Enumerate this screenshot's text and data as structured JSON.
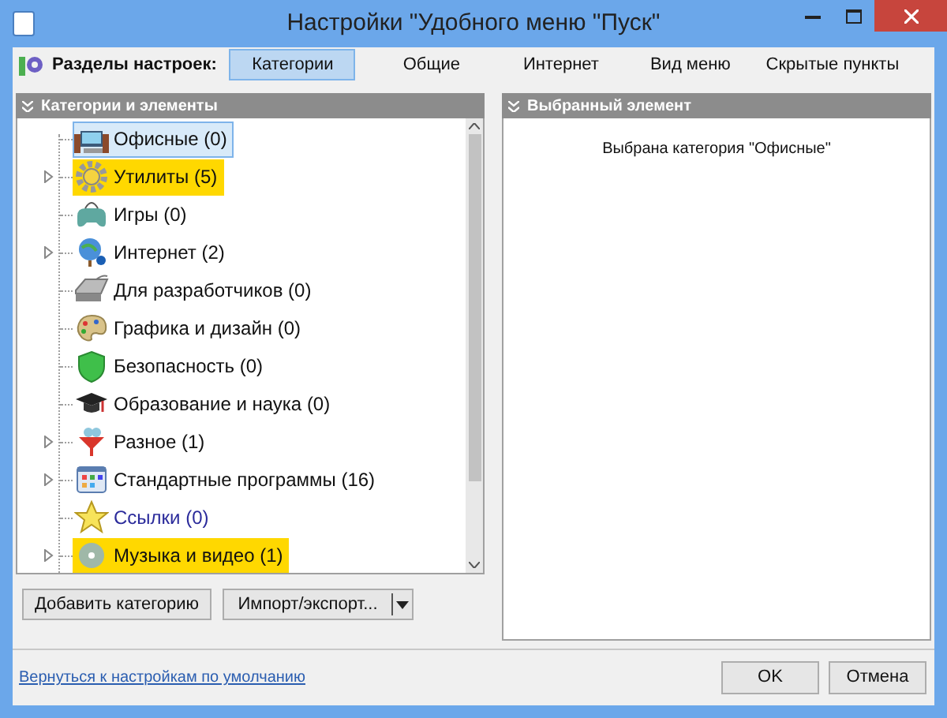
{
  "window": {
    "title": "Настройки \"Удобного меню \"Пуск\""
  },
  "toolbar": {
    "label": "Разделы настроек:",
    "tabs": [
      {
        "label": "Категории",
        "selected": true
      },
      {
        "label": "Общие",
        "selected": false
      },
      {
        "label": "Интернет",
        "selected": false
      },
      {
        "label": "Вид меню",
        "selected": false
      },
      {
        "label": "Скрытые пункты",
        "selected": false
      }
    ]
  },
  "left_panel": {
    "title": "Категории и элементы",
    "tree": [
      {
        "label": "Офисные (0)",
        "kind": "office",
        "selected": true,
        "highlighted": false,
        "expandable": false,
        "link": false
      },
      {
        "label": "Утилиты (5)",
        "kind": "utilities",
        "selected": false,
        "highlighted": true,
        "expandable": true,
        "link": false
      },
      {
        "label": "Игры (0)",
        "kind": "games",
        "selected": false,
        "highlighted": false,
        "expandable": false,
        "link": false
      },
      {
        "label": "Интернет (2)",
        "kind": "internet",
        "selected": false,
        "highlighted": false,
        "expandable": true,
        "link": false
      },
      {
        "label": "Для разработчиков (0)",
        "kind": "developer",
        "selected": false,
        "highlighted": false,
        "expandable": false,
        "link": false
      },
      {
        "label": "Графика и дизайн (0)",
        "kind": "graphics",
        "selected": false,
        "highlighted": false,
        "expandable": false,
        "link": false
      },
      {
        "label": "Безопасность (0)",
        "kind": "security",
        "selected": false,
        "highlighted": false,
        "expandable": false,
        "link": false
      },
      {
        "label": "Образование и наука (0)",
        "kind": "education",
        "selected": false,
        "highlighted": false,
        "expandable": false,
        "link": false
      },
      {
        "label": "Разное (1)",
        "kind": "misc",
        "selected": false,
        "highlighted": false,
        "expandable": true,
        "link": false
      },
      {
        "label": "Стандартные программы (16)",
        "kind": "standard",
        "selected": false,
        "highlighted": false,
        "expandable": true,
        "link": false
      },
      {
        "label": "Ссылки (0)",
        "kind": "links",
        "selected": false,
        "highlighted": false,
        "expandable": false,
        "link": true
      },
      {
        "label": "Музыка и видео (1)",
        "kind": "media",
        "selected": false,
        "highlighted": true,
        "expandable": true,
        "link": false
      }
    ],
    "buttons": [
      "Добавить категорию",
      "Импорт/экспорт..."
    ]
  },
  "right_panel": {
    "title": "Выбранный элемент",
    "message": "Выбрана категория \"Офисные\""
  },
  "footer": {
    "link": "Вернуться к настройкам по умолчанию",
    "buttons": [
      "OK",
      "Отмена"
    ]
  }
}
